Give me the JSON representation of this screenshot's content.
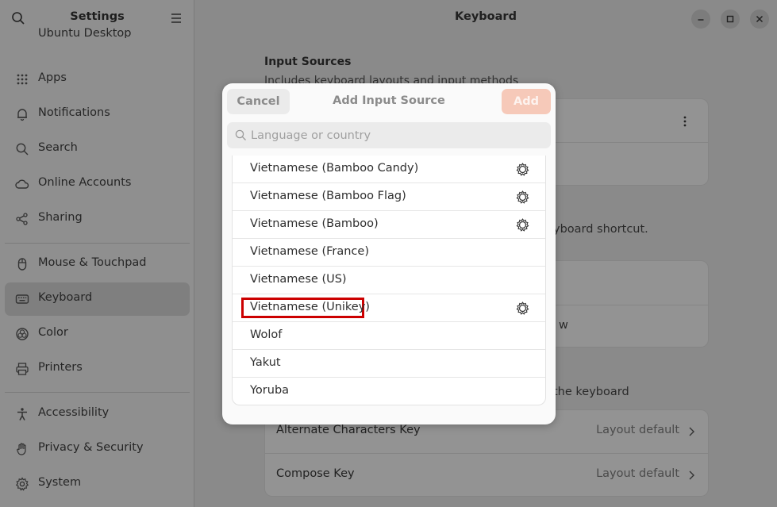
{
  "sidebar": {
    "title": "Settings",
    "partial_item": "Ubuntu Desktop",
    "items": [
      {
        "label": "Apps",
        "icon": "apps-grid-icon"
      },
      {
        "label": "Notifications",
        "icon": "bell-icon"
      },
      {
        "label": "Search",
        "icon": "search-icon"
      },
      {
        "label": "Online Accounts",
        "icon": "cloud-icon"
      },
      {
        "label": "Sharing",
        "icon": "share-icon"
      },
      {
        "label": "Mouse & Touchpad",
        "icon": "mouse-icon"
      },
      {
        "label": "Keyboard",
        "icon": "keyboard-icon",
        "active": true
      },
      {
        "label": "Color",
        "icon": "color-icon"
      },
      {
        "label": "Printers",
        "icon": "printer-icon"
      },
      {
        "label": "Accessibility",
        "icon": "accessibility-icon"
      },
      {
        "label": "Privacy & Security",
        "icon": "hand-icon"
      },
      {
        "label": "System",
        "icon": "gear-icon"
      }
    ]
  },
  "main": {
    "title": "Keyboard",
    "input_sources_title": "Input Sources",
    "input_sources_subtitle": "Includes keyboard layouts and input methods",
    "fragment_shortcut": "yboard shortcut.",
    "fragment_w": "w",
    "fragment_keyboard": "the keyboard",
    "rows": [
      {
        "label": "Alternate Characters Key",
        "value": "Layout default"
      },
      {
        "label": "Compose Key",
        "value": "Layout default"
      }
    ]
  },
  "dialog": {
    "cancel_label": "Cancel",
    "title": "Add Input Source",
    "add_label": "Add",
    "search_placeholder": "Language or country",
    "items": [
      {
        "label": "Vietnamese (Bamboo Candy)",
        "has_settings": true
      },
      {
        "label": "Vietnamese (Bamboo Flag)",
        "has_settings": true
      },
      {
        "label": "Vietnamese (Bamboo)",
        "has_settings": true
      },
      {
        "label": "Vietnamese (France)",
        "has_settings": false
      },
      {
        "label": "Vietnamese (US)",
        "has_settings": false
      },
      {
        "label": "Vietnamese (Unikey)",
        "has_settings": true,
        "highlighted": true
      },
      {
        "label": "Wolof",
        "has_settings": false
      },
      {
        "label": "Yakut",
        "has_settings": false
      },
      {
        "label": "Yoruba",
        "has_settings": false
      }
    ]
  },
  "colors": {
    "accent_add": "#f6c9b9",
    "highlight_box": "#cc0000"
  }
}
